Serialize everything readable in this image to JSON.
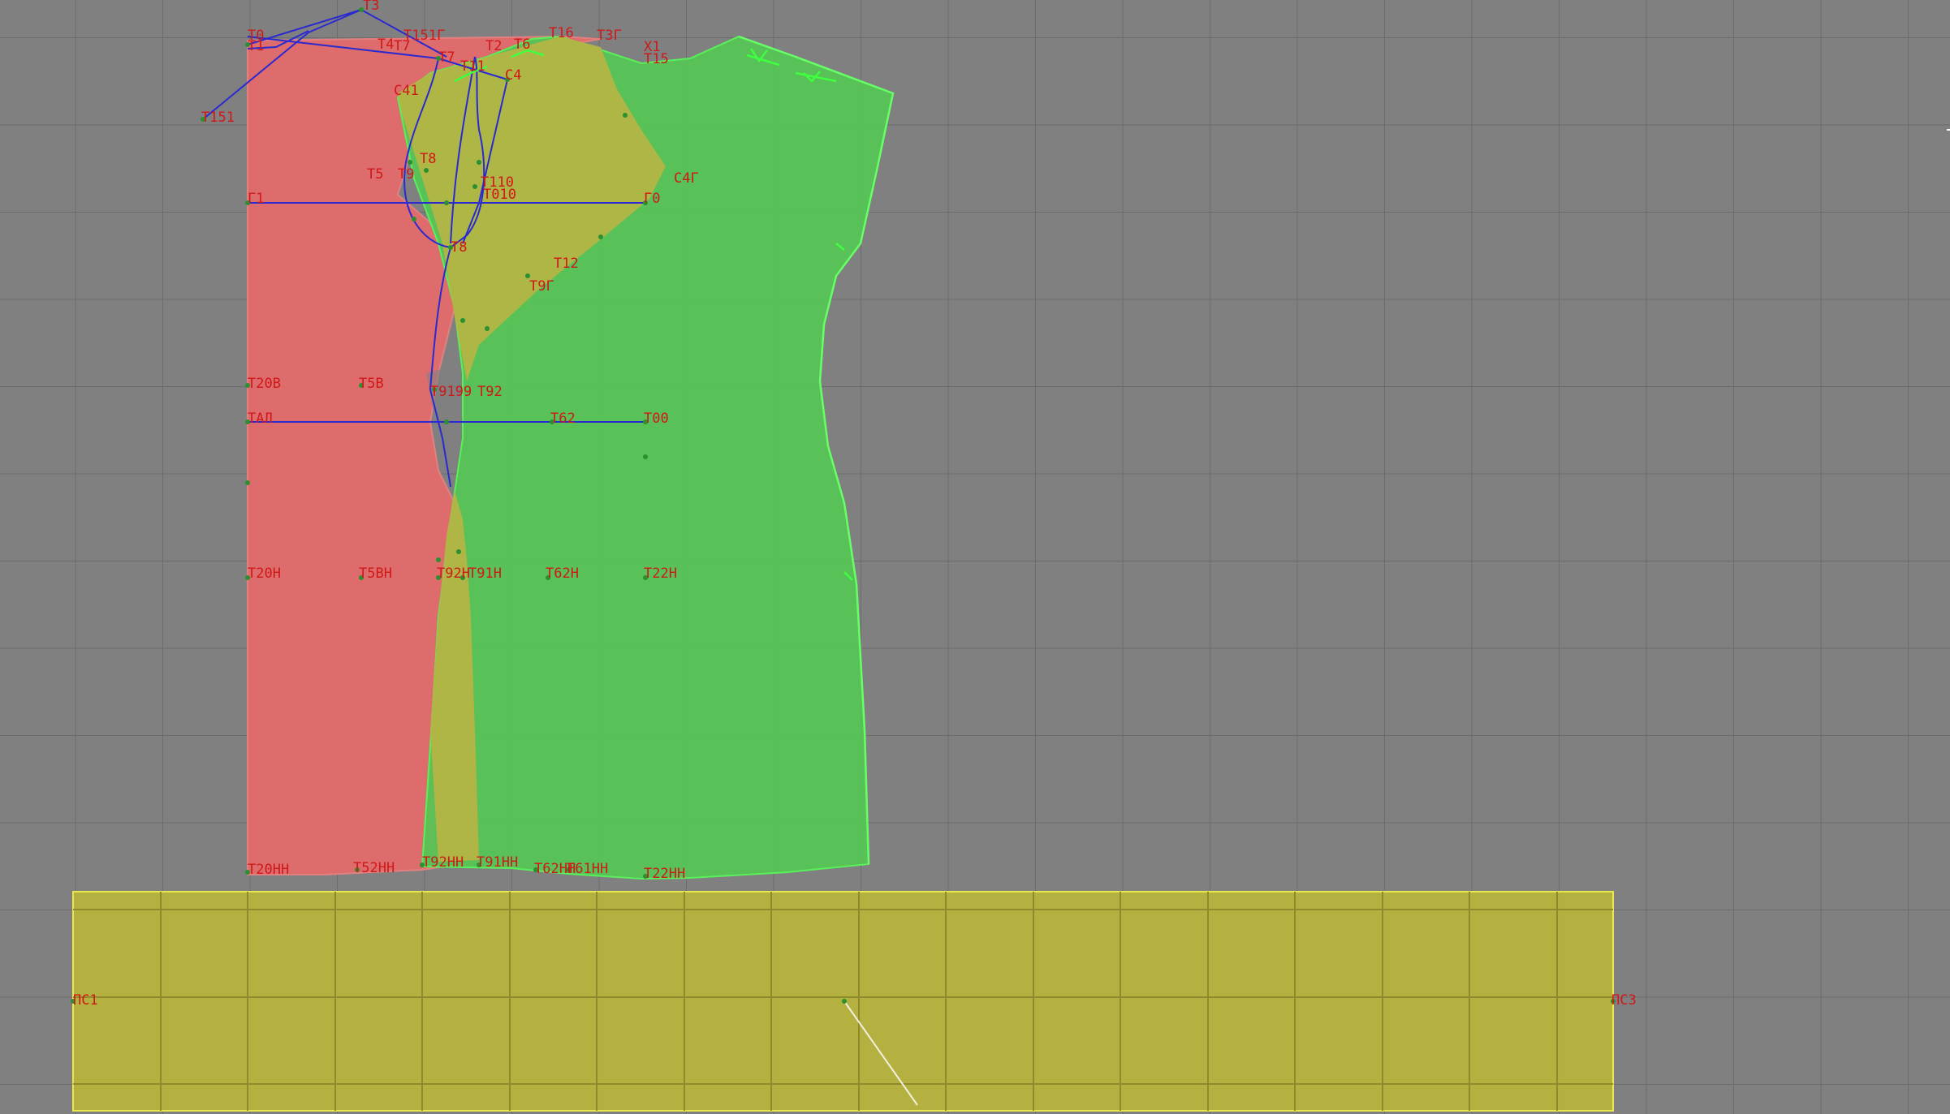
{
  "colors": {
    "background": "#808080",
    "grid": "#6e6e6e",
    "back_piece_fill": "#e66a6a",
    "front_piece_fill": "#55c455",
    "overlap_fill": "#b3b544",
    "strip_fill": "#b7b33c",
    "construction_lines": "#2a2ad0",
    "point_labels": "#d01818",
    "front_outline": "#4ef04e"
  },
  "points": {
    "t3": "Т3",
    "t0": "Т0",
    "t1": "Т1",
    "t151g": "Т151Г",
    "t4": "Т4",
    "t7x": "Т7",
    "t7": "Т7",
    "t2": "Т2",
    "t6": "Т6",
    "t16": "Т16",
    "t3g": "Т3Г",
    "x1": "Х1",
    "t15": "Т15",
    "t11": "Т11",
    "c4": "С4",
    "c41": "С41",
    "t151": "Т151",
    "t8": "Т8",
    "t5": "Т5",
    "t9": "Т9",
    "t110": "Т110",
    "t010": "Т010",
    "g1": "Г1",
    "g0": "Г0",
    "c4g": "С4Г",
    "t8b": "Т8",
    "t12": "Т12",
    "t9g": "Т9Г",
    "t20v": "Т20В",
    "t5v": "Т5В",
    "t9199": "Т9199",
    "t92": "Т92",
    "tal": "ТАЛ",
    "t62": "Т62",
    "t00": "Т00",
    "t20n": "Т20Н",
    "t5bn": "Т5ВН",
    "t92h": "Т92Н",
    "t91h": "Т91Н",
    "t62h": "Т62Н",
    "t22h": "Т22Н",
    "t20nn": "Т20НН",
    "t52nn": "Т52НН",
    "t92nn": "Т92НН",
    "t91nn": "Т91НН",
    "t62nn": "Т62НН",
    "t61nn": "Т61НН",
    "t22nn": "Т22НН",
    "ps1": "ПС1",
    "ps3": "ПС3"
  }
}
